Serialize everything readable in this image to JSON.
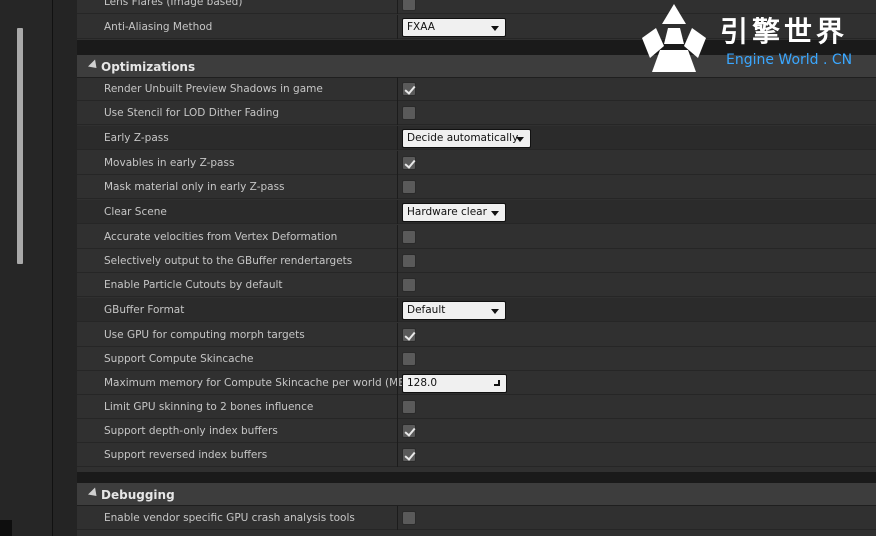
{
  "watermark": {
    "title_zh": "引擎世界",
    "subtitle_en": "Engine World . CN",
    "logo_icon": "engine-world-logo-icon"
  },
  "rows_top": [
    {
      "label": "Lens Flares (Image based)",
      "type": "checkbox",
      "checked": false
    },
    {
      "label": "Anti-Aliasing Method",
      "type": "combo",
      "value": "FXAA"
    }
  ],
  "optimizations": {
    "title": "Optimizations",
    "rows": [
      {
        "label": "Render Unbuilt Preview Shadows in game",
        "type": "checkbox",
        "checked": true
      },
      {
        "label": "Use Stencil for LOD Dither Fading",
        "type": "checkbox",
        "checked": false
      },
      {
        "label": "Early Z-pass",
        "type": "combo",
        "value": "Decide automatically"
      },
      {
        "label": "Movables in early Z-pass",
        "type": "checkbox",
        "checked": true
      },
      {
        "label": "Mask material only in early Z-pass",
        "type": "checkbox",
        "checked": false
      },
      {
        "label": "Clear Scene",
        "type": "combo",
        "value": "Hardware clear"
      },
      {
        "label": "Accurate velocities from Vertex Deformation",
        "type": "checkbox",
        "checked": false
      },
      {
        "label": "Selectively output to the GBuffer rendertargets",
        "type": "checkbox",
        "checked": false
      },
      {
        "label": "Enable Particle Cutouts by default",
        "type": "checkbox",
        "checked": false
      },
      {
        "label": "GBuffer Format",
        "type": "combo",
        "value": "Default"
      },
      {
        "label": "Use GPU for computing morph targets",
        "type": "checkbox",
        "checked": true
      },
      {
        "label": "Support Compute Skincache",
        "type": "checkbox",
        "checked": false
      },
      {
        "label": "Maximum memory for Compute Skincache per world (MB)",
        "type": "number",
        "value": "128.0"
      },
      {
        "label": "Limit GPU skinning to 2 bones influence",
        "type": "checkbox",
        "checked": false
      },
      {
        "label": "Support depth-only index buffers",
        "type": "checkbox",
        "checked": true
      },
      {
        "label": "Support reversed index buffers",
        "type": "checkbox",
        "checked": true
      }
    ]
  },
  "debugging": {
    "title": "Debugging",
    "rows": [
      {
        "label": "Enable vendor specific GPU crash analysis tools",
        "type": "checkbox",
        "checked": false
      }
    ]
  }
}
